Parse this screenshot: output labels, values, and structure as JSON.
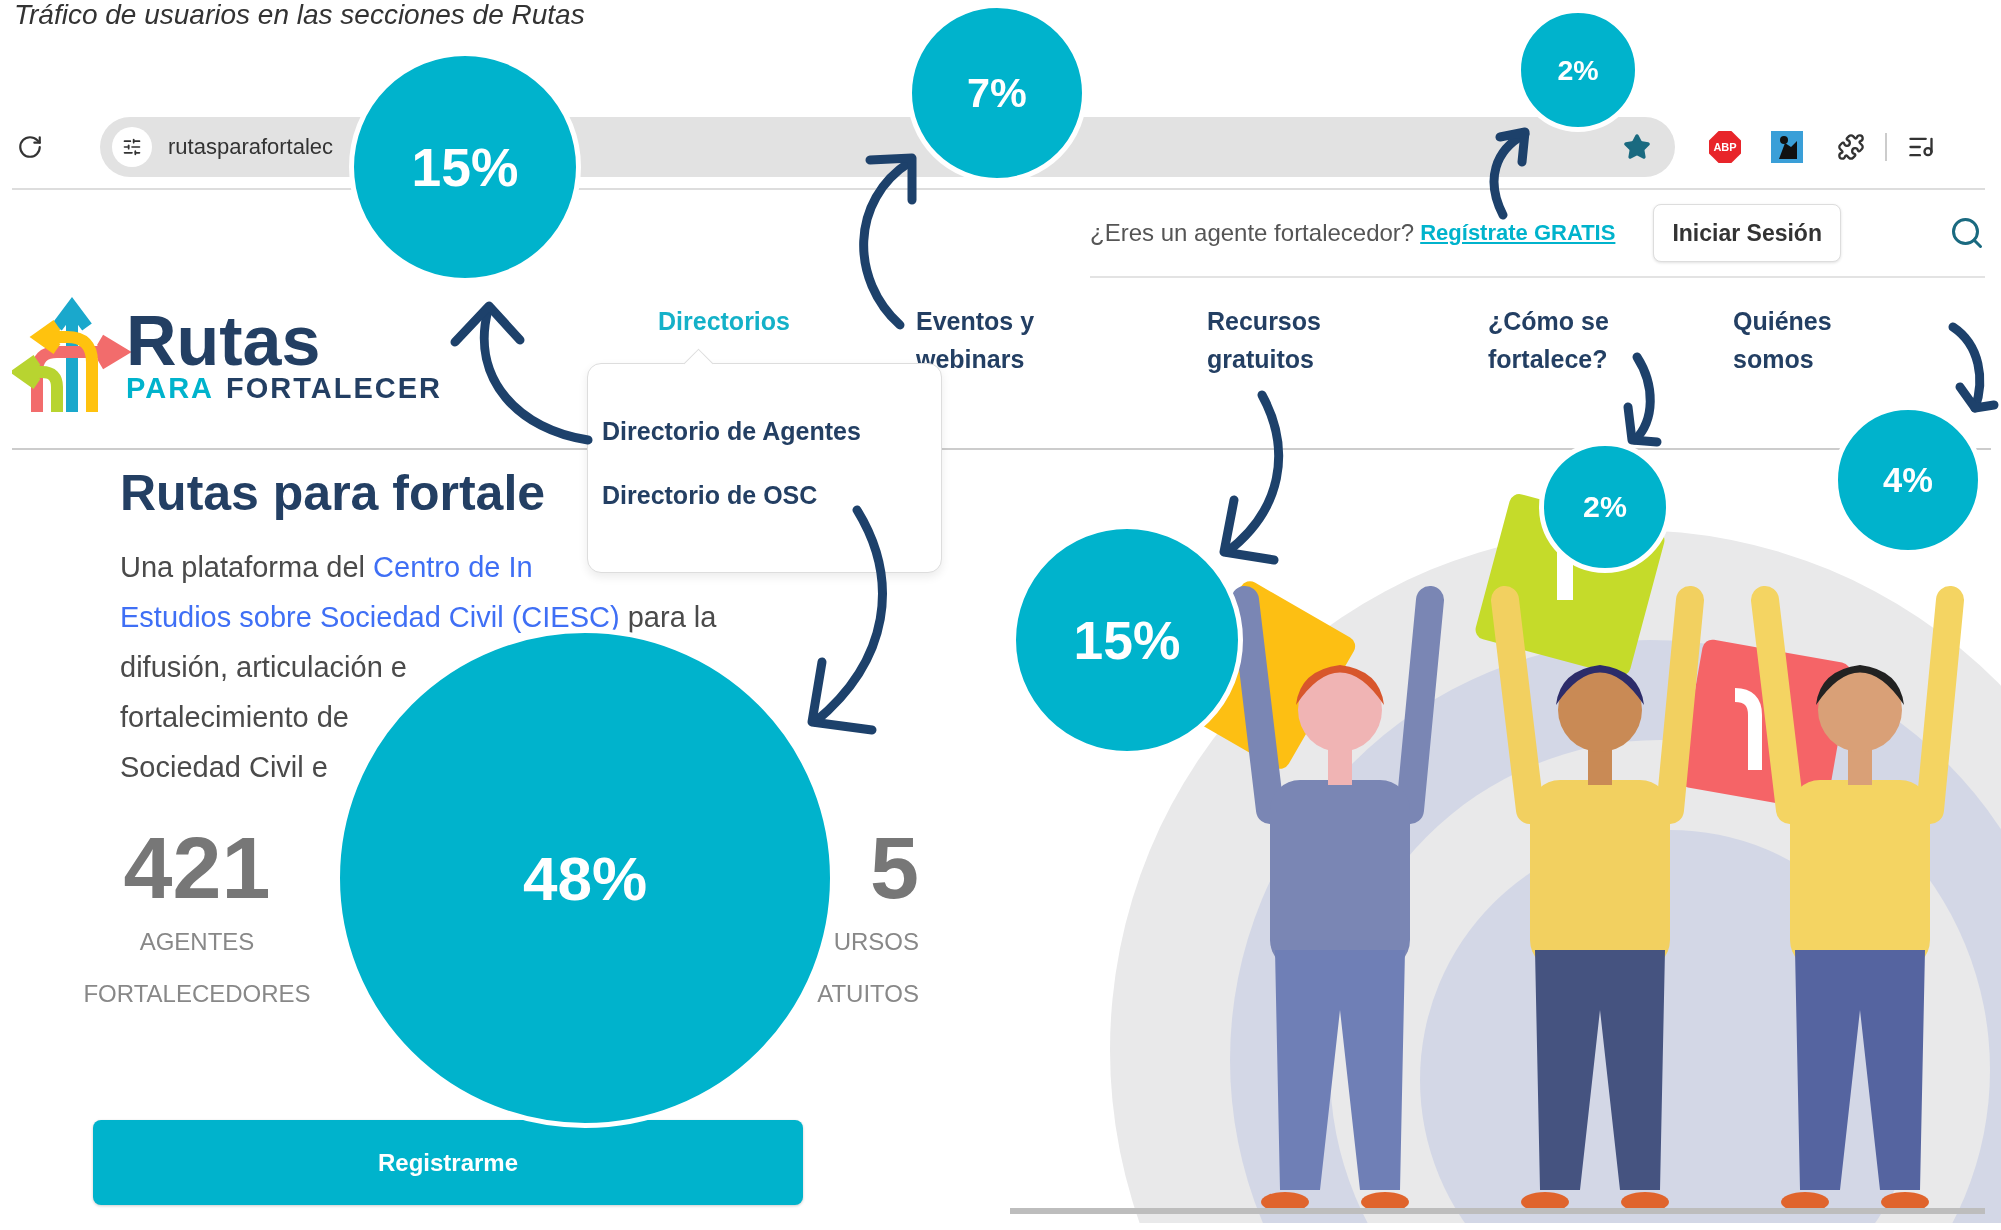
{
  "caption": "Tráfico de usuarios en las secciones de Rutas",
  "browser": {
    "url": "rutasparafortalec",
    "bookmarked": true,
    "adblock_label": "ABP"
  },
  "topbar": {
    "question": "¿Eres un agente fortalecedor?",
    "register_link": "Regístrate GRATIS",
    "login_button": "Iniciar Sesión"
  },
  "logo": {
    "title": "Rutas",
    "subtitle_1": "PARA",
    "subtitle_2": "FORTALECER"
  },
  "nav": [
    {
      "label": "Directorios",
      "selected": true
    },
    {
      "label": "Eventos y webinars",
      "selected": false
    },
    {
      "label": "Recursos gratuitos",
      "selected": false
    },
    {
      "label": "¿Cómo se fortalece?",
      "selected": false
    },
    {
      "label": "Quiénes somos",
      "selected": false
    }
  ],
  "dropdown": [
    "Directorio de Agentes",
    "Directorio de OSC"
  ],
  "hero": {
    "title": "Rutas para fortale",
    "lines": [
      [
        {
          "text": "Una plataforma del ",
          "link": false
        },
        {
          "text": "Centro de In",
          "link": true
        }
      ],
      [
        {
          "text": "Estudios sobre Sociedad Civil (CIESC)",
          "link": true
        },
        {
          "text": " para la",
          "link": false
        }
      ],
      [
        {
          "text": "difusión, articulación e",
          "link": false
        }
      ],
      [
        {
          "text": "fortalecimiento de",
          "link": false
        }
      ],
      [
        {
          "text": "Sociedad Civil e",
          "link": false
        }
      ]
    ]
  },
  "stats": [
    {
      "value": "421",
      "label_lines": [
        "AGENTES",
        "FORTALECEDORES"
      ]
    },
    {
      "value": "5",
      "label_lines": [
        "URSOS",
        "ATUITOS"
      ]
    }
  ],
  "register_button": "Registrarme",
  "annotations": [
    "15%",
    "7%",
    "2%",
    "48%",
    "15%",
    "2%",
    "4%"
  ]
}
